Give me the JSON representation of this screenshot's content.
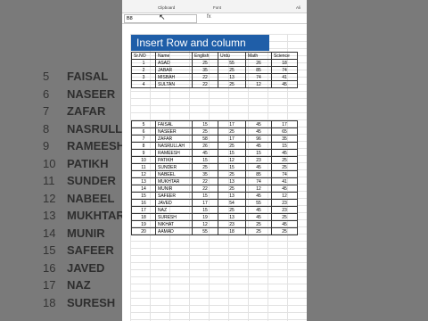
{
  "background_names": [
    "FAISAL",
    "NASEER",
    "ZAFAR",
    "NASRULLAH",
    "RAMEESH",
    "PATIKH",
    "SUNDER",
    "NABEEL",
    "MUKHTAR",
    "MUNIR",
    "SAFEER",
    "JAVED",
    "NAZ",
    "SURESH"
  ],
  "background_nums": [
    "5",
    "6",
    "7",
    "8",
    "9",
    "10",
    "11",
    "12",
    "13",
    "14",
    "15",
    "16",
    "17",
    "18"
  ],
  "ribbon": {
    "clipboard": "Clipboard",
    "font": "Font",
    "alignment": "Ali"
  },
  "name_box": "B8",
  "fx_label": "fx",
  "title": "Insert Row and column",
  "headers": [
    "Sr.NO",
    "Name",
    "English",
    "Urdu",
    "Math",
    "Science"
  ],
  "rows_top": [
    [
      "1",
      "ASAD",
      "25",
      "55",
      "26",
      "18"
    ],
    [
      "2",
      "JABAR",
      "35",
      "25",
      "85",
      "74"
    ],
    [
      "3",
      "MISBAH",
      "22",
      "13",
      "74",
      "41"
    ],
    [
      "4",
      "SULTAN",
      "22",
      "25",
      "12",
      "45"
    ]
  ],
  "rows_bottom": [
    [
      "5",
      "FAISAL",
      "15",
      "17",
      "45",
      "17"
    ],
    [
      "6",
      "NASEER",
      "25",
      "25",
      "45",
      "65"
    ],
    [
      "7",
      "ZAFAR",
      "58",
      "17",
      "96",
      "35"
    ],
    [
      "8",
      "NASRULLAH",
      "26",
      "25",
      "45",
      "15"
    ],
    [
      "9",
      "RAMEESH",
      "45",
      "15",
      "15",
      "45"
    ],
    [
      "10",
      "PATIKH",
      "15",
      "12",
      "23",
      "25"
    ],
    [
      "11",
      "SUNDER",
      "25",
      "15",
      "45",
      "25"
    ],
    [
      "12",
      "NABEEL",
      "35",
      "25",
      "85",
      "74"
    ],
    [
      "13",
      "MUKHTAR",
      "22",
      "13",
      "74",
      "41"
    ],
    [
      "14",
      "MUNIR",
      "22",
      "25",
      "12",
      "45"
    ],
    [
      "15",
      "SAFEER",
      "15",
      "13",
      "45",
      "12"
    ],
    [
      "16",
      "JAVED",
      "17",
      "54",
      "55",
      "23"
    ],
    [
      "17",
      "NAZ",
      "15",
      "25",
      "45",
      "23"
    ],
    [
      "18",
      "SURESH",
      "19",
      "13",
      "45",
      "25"
    ],
    [
      "19",
      "NIKHAT",
      "12",
      "23",
      "25",
      "45"
    ],
    [
      "20",
      "AAMAD",
      "55",
      "18",
      "25",
      "25"
    ]
  ]
}
